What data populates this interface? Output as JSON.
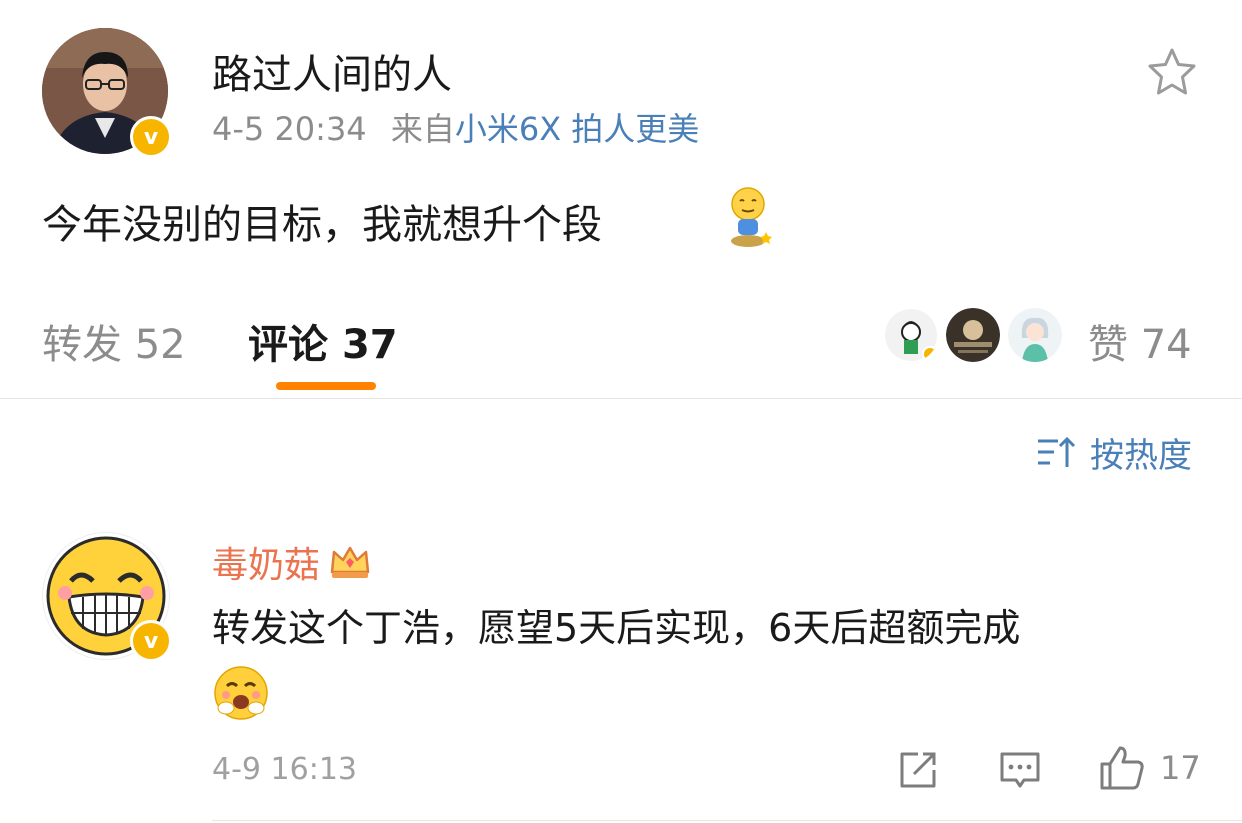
{
  "post": {
    "username": "路过人间的人",
    "time": "4-5 20:34",
    "source_prefix": "来自",
    "source": "小米6X 拍人更美",
    "text": "今年没别的目标，我就想升个段"
  },
  "tabs": {
    "repost_label": "转发",
    "repost_count": "52",
    "comment_label": "评论",
    "comment_count": "37",
    "like_label": "赞",
    "like_count": "74"
  },
  "sort": {
    "label": "按热度"
  },
  "comments": [
    {
      "username": "毒奶菇",
      "text": "转发这个丁浩，愿望5天后实现，6天后超额完成",
      "time": "4-9 16:13",
      "like_count": "17"
    }
  ],
  "colors": {
    "accent": "#ff8200",
    "link": "#4a7fb8",
    "comment_name": "#eb7350",
    "verified": "#f7b500"
  },
  "icons": [
    "star-icon",
    "verified-badge-icon",
    "sort-icon",
    "repost-icon",
    "reply-icon",
    "like-icon",
    "crown-icon"
  ]
}
